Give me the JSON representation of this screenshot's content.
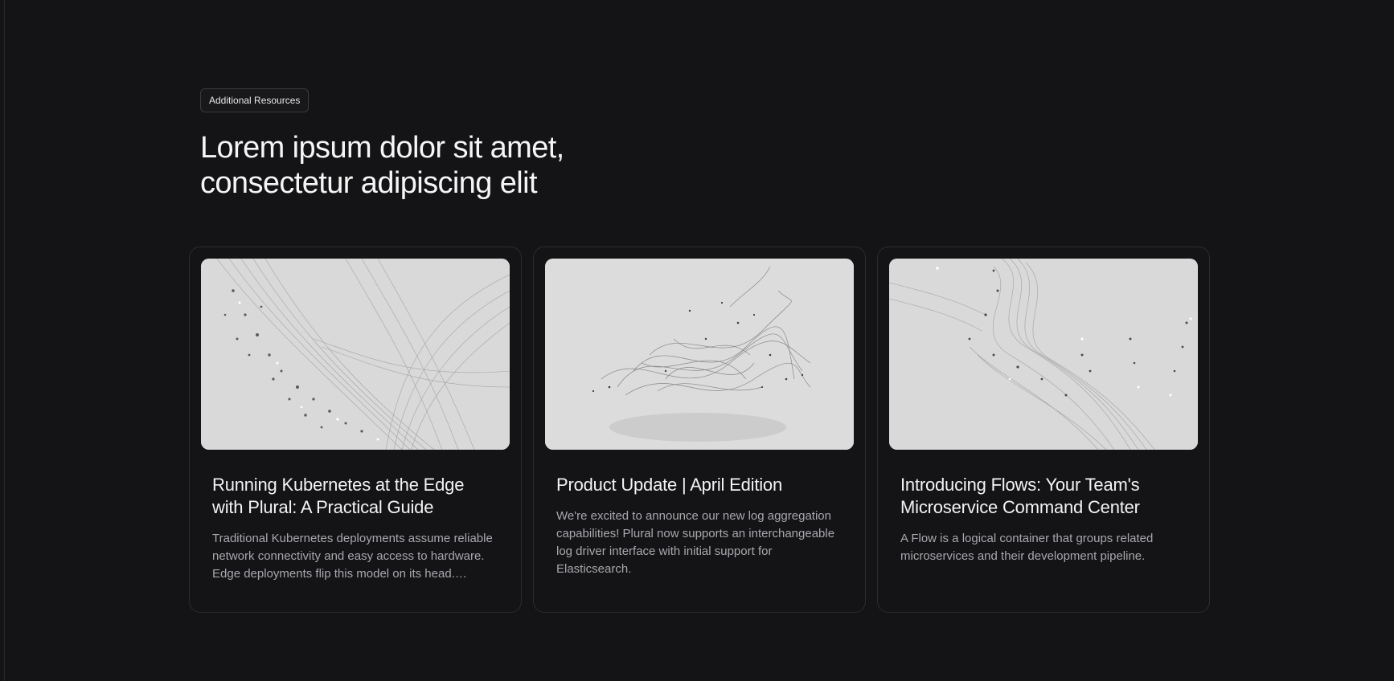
{
  "section": {
    "badge": "Additional Resources",
    "heading": "Lorem ipsum dolor sit amet, consectetur adipiscing elit"
  },
  "cards": [
    {
      "title": "Running Kubernetes at the Edge with Plural: A Practical Guide",
      "description": "Traditional Kubernetes deployments assume reliable network connectivity and easy access to hardware. Edge deployments flip this model on its head. You're..."
    },
    {
      "title": "Product Update | April Edition",
      "description": "We're excited to announce our new log aggregation capabilities! Plural now supports an interchangeable log driver interface with initial support for Elasticsearch."
    },
    {
      "title": "Introducing Flows: Your Team's Microservice Command Center",
      "description": "A Flow is a logical container that groups related microservices and their development pipeline."
    }
  ],
  "colors": {
    "background": "#141416",
    "card_border": "#2c2c30",
    "text_primary": "#f3f3f4",
    "text_secondary": "#a8a8ae"
  }
}
